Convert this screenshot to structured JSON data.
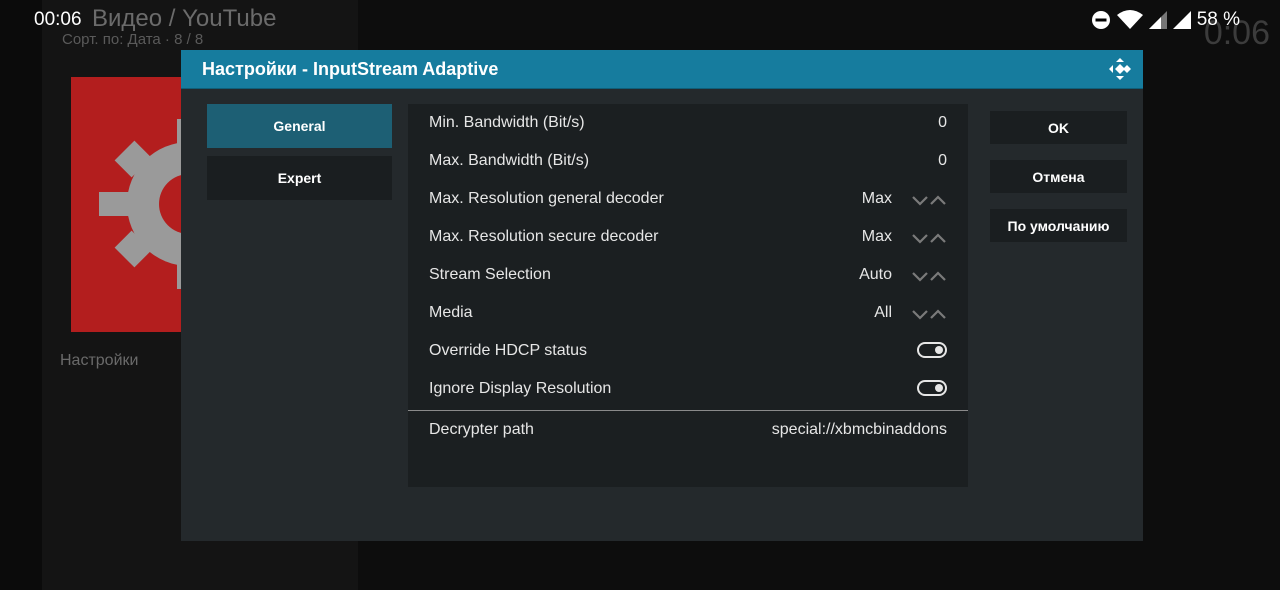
{
  "background": {
    "title": "Видео / YouTube",
    "sort_info": "Сорт. по: Дата  ·  8 / 8",
    "clock": "0:06",
    "settings_label": "Настройки",
    "poster_color": "#b31e1e"
  },
  "status_bar": {
    "time": "00:06",
    "battery": "58 %",
    "icons": [
      "do-not-disturb-icon",
      "wifi-icon",
      "signal-icon",
      "signal-icon",
      "battery-icon"
    ]
  },
  "dialog": {
    "title": "Настройки - InputStream Adaptive",
    "header_color": "#167c9e",
    "categories": [
      {
        "label": "General",
        "active": true
      },
      {
        "label": "Expert",
        "active": false
      }
    ],
    "settings": [
      {
        "label": "Min. Bandwidth (Bit/s)",
        "value": "0",
        "control": "none"
      },
      {
        "label": "Max. Bandwidth (Bit/s)",
        "value": "0",
        "control": "none"
      },
      {
        "label": "Max. Resolution general decoder",
        "value": "Max",
        "control": "spinner"
      },
      {
        "label": "Max. Resolution secure decoder",
        "value": "Max",
        "control": "spinner"
      },
      {
        "label": "Stream Selection",
        "value": "Auto",
        "control": "spinner"
      },
      {
        "label": "Media",
        "value": "All",
        "control": "spinner"
      },
      {
        "label": "Override HDCP status",
        "value": "on",
        "control": "toggle"
      },
      {
        "label": "Ignore Display Resolution",
        "value": "on",
        "control": "toggle"
      },
      {
        "label": "Decrypter path",
        "value": "special://xbmcbinaddons",
        "control": "none"
      }
    ],
    "buttons": [
      {
        "label": "OK"
      },
      {
        "label": "Отмена"
      },
      {
        "label": "По умолчанию"
      }
    ]
  }
}
